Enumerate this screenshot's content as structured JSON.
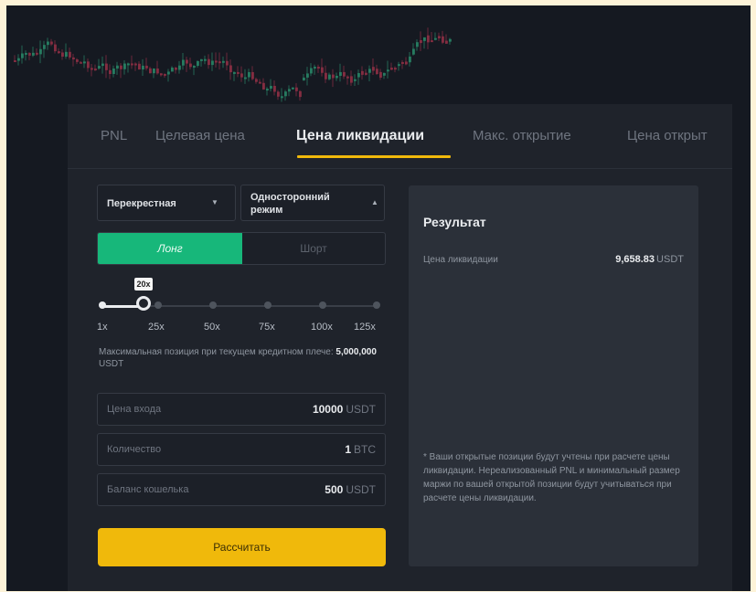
{
  "tabs": [
    {
      "label": "PNL",
      "active": false
    },
    {
      "label": "Целевая цена",
      "active": false
    },
    {
      "label": "Цена ликвидации",
      "active": true
    },
    {
      "label": "Макс. открытие",
      "active": false
    },
    {
      "label": "Цена открыт",
      "active": false
    }
  ],
  "margin_mode": {
    "label": "Перекрестная",
    "arrow": "▼"
  },
  "position_mode": {
    "label_line1": "Односторонний",
    "label_line2": "режим",
    "arrow": "▲"
  },
  "side_toggle": {
    "long": "Лонг",
    "short": "Шорт",
    "selected": "long"
  },
  "leverage": {
    "current": "20x",
    "current_value": 20,
    "max_value": 125,
    "labels": [
      "1x",
      "25x",
      "50x",
      "75x",
      "100x",
      "125x"
    ]
  },
  "max_position": {
    "text": "Максимальная позиция при текущем кредитном плече:",
    "value": "5,000,000",
    "unit": "USDT"
  },
  "fields": [
    {
      "label": "Цена входа",
      "value": "10000",
      "unit": "USDT"
    },
    {
      "label": "Количество",
      "value": "1",
      "unit": "BTC"
    },
    {
      "label": "Баланс кошелька",
      "value": "500",
      "unit": "USDT"
    }
  ],
  "calculate_label": "Рассчитать",
  "result": {
    "title": "Результат",
    "liq_label": "Цена ликвидации",
    "liq_value": "9,658.83",
    "liq_unit": "USDT",
    "note": "* Ваши открытые позиции будут учтены при расчете цены ликвидации. Нереализованный PNL и минимальный размер маржи по вашей открытой позиции будут учитываться при расчете цены ликвидации."
  },
  "colors": {
    "accent": "#f0b90b",
    "long": "#17b77a",
    "background": "#1f232b"
  }
}
